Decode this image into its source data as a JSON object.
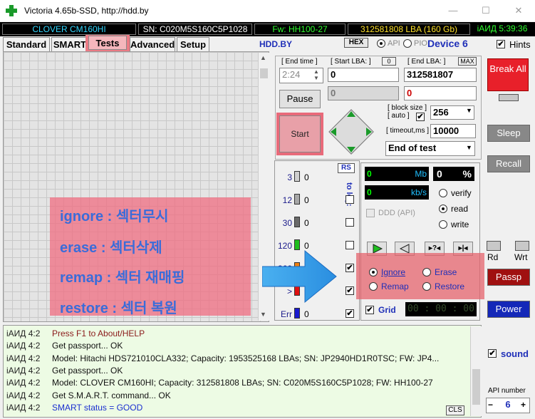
{
  "window": {
    "title": "Victoria 4.65b-SSD, http://hdd.by",
    "minimize": "—",
    "maximize": "☐",
    "close": "✕"
  },
  "info": {
    "model": "CLOVER  CM160HI",
    "serial": "SN: C020M5S160C5P1028",
    "firmware": "Fw: HH100-27",
    "lba": "312581808 LBA (160 Gb)",
    "time": "іАИД 5:39:36"
  },
  "tabs": [
    "Standard",
    "SMART",
    "Tests",
    "Advanced",
    "Setup"
  ],
  "toolbar": {
    "brand": "HDD.BY",
    "hex": "HEX",
    "api": "API",
    "pio": "PIO",
    "device": "Device 6",
    "hints": "Hints"
  },
  "controls": {
    "end_time_label": "[ End time ]",
    "end_time": "2:24",
    "start_lba_label": "[ Start LBA: ]",
    "start_lba_zero": "0",
    "start_lba": "0",
    "start_lba2": "0",
    "end_lba_label": "[ End LBA: ]",
    "end_lba_max": "MAX",
    "end_lba": "312581807",
    "end_lba2": "0",
    "pause": "Pause",
    "start": "Start",
    "block_size_label": "[ block size ]",
    "auto_label": "[ auto ]",
    "block_size": "256",
    "timeout_label": "[ timeout,ms ]",
    "timeout": "10000",
    "end_action": "End of test"
  },
  "blocks": {
    "rs": "RS",
    "to_log": "to log:",
    "rows": [
      {
        "ms": "3",
        "count": "0",
        "color": "#d0d0d0"
      },
      {
        "ms": "12",
        "count": "0",
        "color": "#a8a8a8"
      },
      {
        "ms": "30",
        "count": "0",
        "color": "#6a6a6a"
      },
      {
        "ms": "120",
        "count": "0",
        "color": "#1fbf1f"
      },
      {
        "ms": "360",
        "count": "0",
        "color": "#f08010"
      },
      {
        "ms": ">",
        "count": "0",
        "color": "#e01010"
      },
      {
        "ms": "Err",
        "count": "0",
        "color": "#1a1ad0"
      }
    ]
  },
  "stats": {
    "mb": "0",
    "mb_unit": "Mb",
    "pct": "0",
    "pct_unit": "%",
    "kbs": "0",
    "kbs_unit": "kb/s",
    "verify": "verify",
    "read": "read",
    "write": "write",
    "ddd": "DDD (API)",
    "ignore": "Ignore",
    "erase": "Erase",
    "remap": "Remap",
    "restore": "Restore",
    "grid": "Grid",
    "timer": "00 : 00 : 00"
  },
  "annotations": [
    "ignore : 섹터무시",
    "erase : 섹터삭제",
    "remap : 섹터 재매핑",
    "restore : 섹터 복원"
  ],
  "right": {
    "break": "Break All",
    "sleep": "Sleep",
    "recall": "Recall",
    "rd": "Rd",
    "wrt": "Wrt",
    "passp": "Passp",
    "power": "Power",
    "sound": "sound",
    "api_number_label": "API number",
    "api_number": "6"
  },
  "log": {
    "cls": "CLS",
    "rows": [
      {
        "who": "іАИД 4:2",
        "text": "Press F1 to About/HELP",
        "color": "#8a1a1a"
      },
      {
        "who": "іАИД 4:2",
        "text": "Get passport... OK",
        "color": "#111"
      },
      {
        "who": "іАИД 4:2",
        "text": "Model: Hitachi HDS721010CLA332; Capacity: 1953525168 LBAs; SN: JP2940HD1R0TSC; FW: JP4...",
        "color": "#111"
      },
      {
        "who": "іАИД 4:2",
        "text": "Get passport... OK",
        "color": "#111"
      },
      {
        "who": "іАИД 4:2",
        "text": "Model: CLOVER  CM160HI; Capacity: 312581808 LBAs; SN: C020M5S160C5P1028; FW: HH100-27",
        "color": "#111"
      },
      {
        "who": "іАИД 4:2",
        "text": "Get S.M.A.R.T. command... OK",
        "color": "#111"
      },
      {
        "who": "іАИД 4:2",
        "text": "SMART status = GOOD",
        "color": "#1a2fd0"
      }
    ]
  }
}
